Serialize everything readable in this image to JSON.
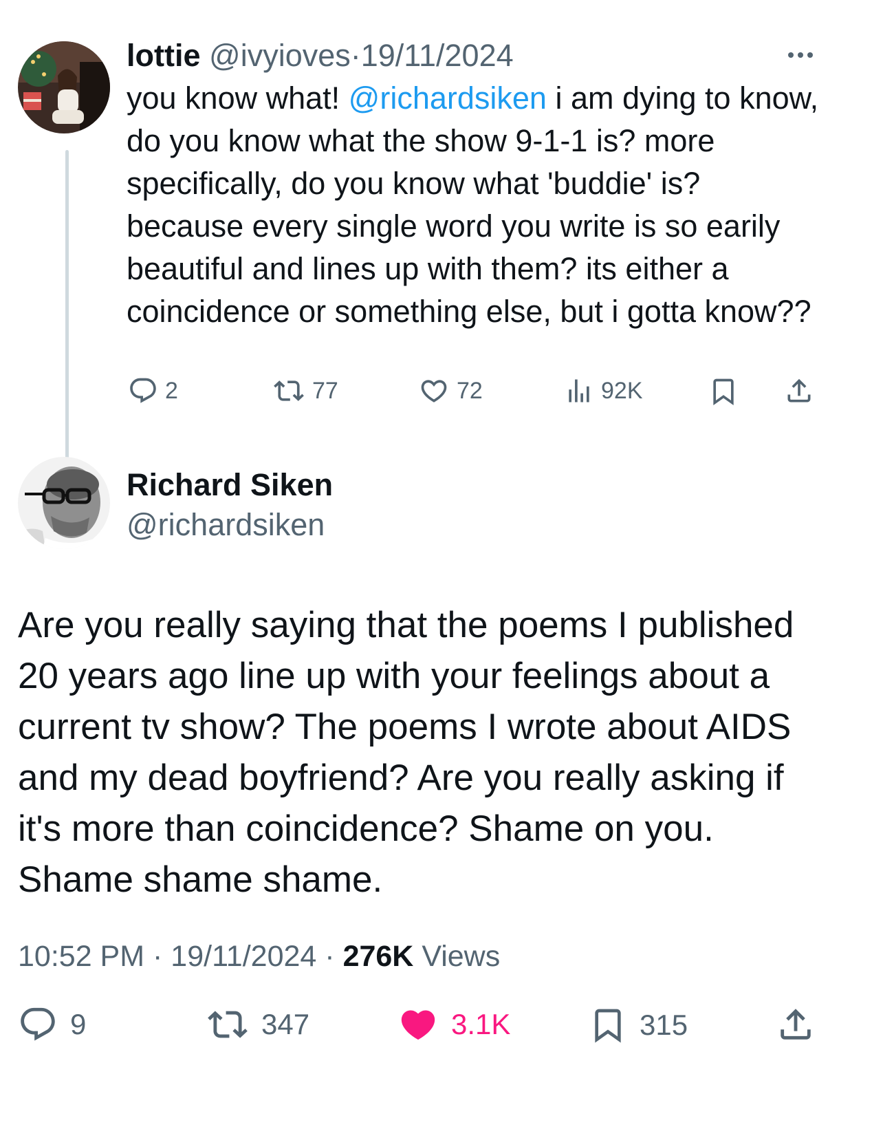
{
  "colors": {
    "accent": "#1d9bf0",
    "muted": "#536471",
    "like": "#f91880",
    "text": "#0f1419"
  },
  "parent": {
    "name": "lottie",
    "handle": "@ivyioves",
    "sep": "·",
    "date": "19/11/2024",
    "text_part1": "you know what! ",
    "mention": "@richardsiken",
    "text_part2": " i am dying to know, do you know what the show 9-1-1 is? more specifically, do you know what 'buddie' is? because every single word you write is so earily beautiful and lines up with them? its either a coincidence or something else, but i gotta know??",
    "replies": "2",
    "retweets": "77",
    "likes": "72",
    "views": "92K",
    "more_icon": "more-icon"
  },
  "main": {
    "name": "Richard Siken",
    "handle": "@richardsiken",
    "text": "Are you really saying that the poems I published 20 years ago line up with your feelings about a current tv show? The poems I wrote about AIDS and my dead boyfriend? Are you really asking if it's more than coincidence? Shame on you. Shame shame shame.",
    "time": "10:52 PM",
    "sep1": "·",
    "date": "19/11/2024",
    "sep2": "·",
    "views_count": "276K",
    "views_label": "Views",
    "replies": "9",
    "retweets": "347",
    "likes": "3.1K",
    "bookmarks": "315"
  }
}
